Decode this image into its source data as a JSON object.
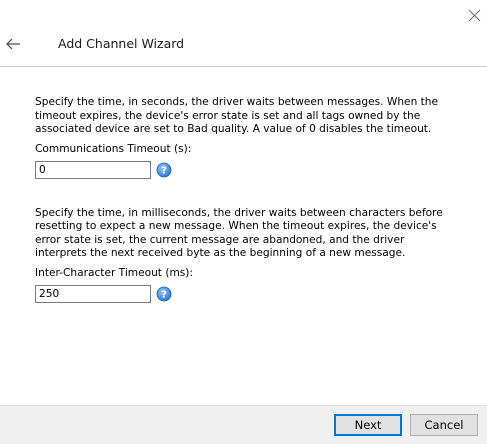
{
  "window": {
    "title": "Add Channel Wizard"
  },
  "icons": {
    "close": "close-icon",
    "back": "back-arrow-icon",
    "help": "help-icon"
  },
  "communications_timeout": {
    "description": "Specify the time, in seconds, the driver waits between messages. When the timeout expires, the device's error state is set and all tags owned by the associated device are set to Bad quality. A value of 0 disables the timeout.",
    "label": "Communications Timeout (s):",
    "value": "0"
  },
  "inter_character_timeout": {
    "description": "Specify the time, in milliseconds, the driver waits between characters before resetting to expect a new message. When the timeout expires, the device's error state is set, the current message are abandoned, and the driver interprets the next received byte as the beginning of a new message.",
    "label": "Inter-Character Timeout (ms):",
    "value": "250"
  },
  "footer": {
    "next_label": "Next",
    "cancel_label": "Cancel"
  },
  "colors": {
    "accent": "#0078d7",
    "help_icon_blue": "#2f7bd6",
    "footer_bg": "#f0f0f0"
  }
}
